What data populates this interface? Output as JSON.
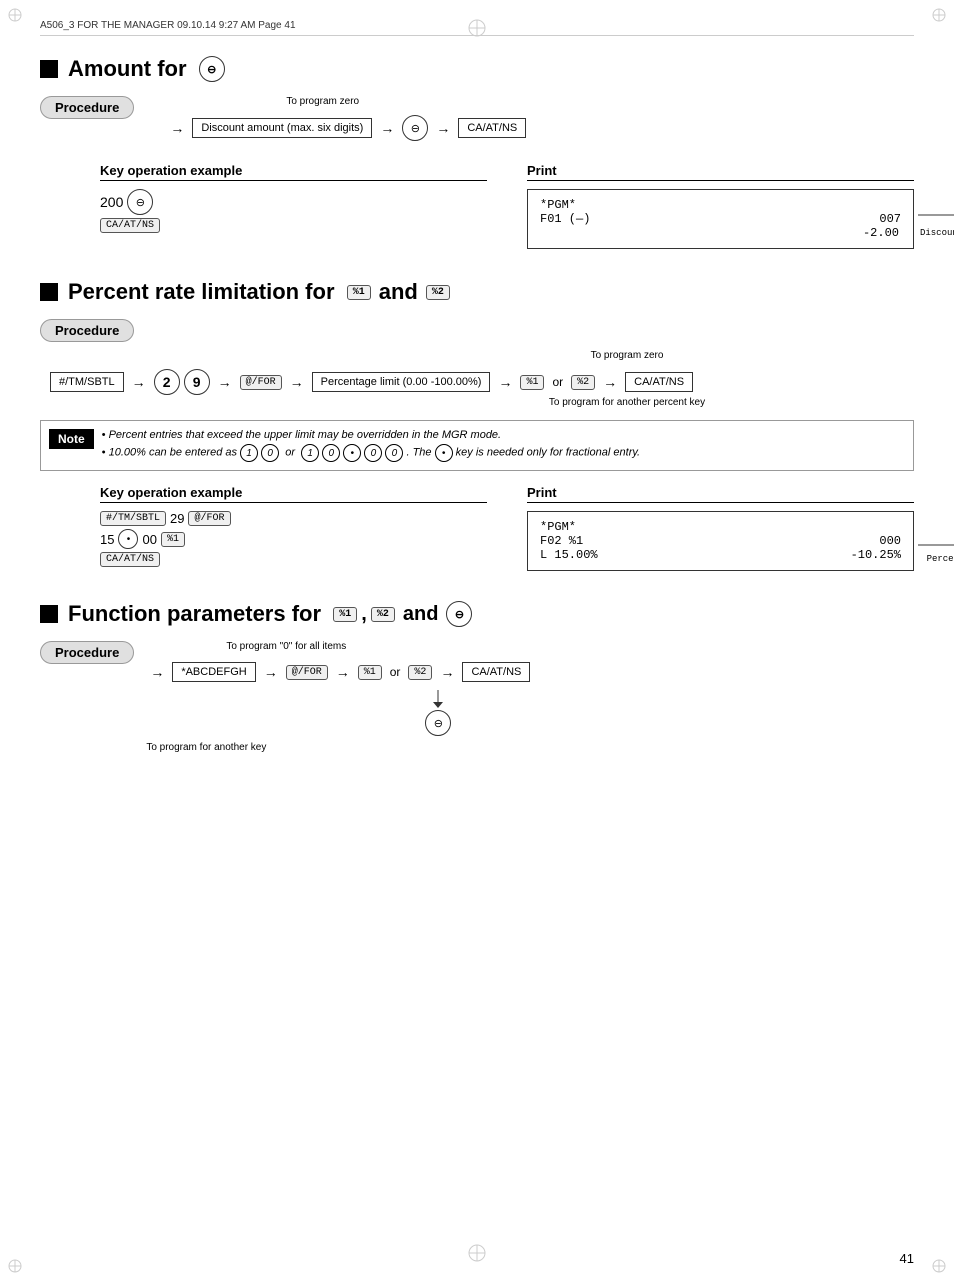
{
  "header": {
    "text": "A506_3 FOR THE MANAGER  09.10.14 9:27 AM  Page 41"
  },
  "page_number": "41",
  "sections": [
    {
      "id": "amount_for",
      "heading": "Amount for",
      "heading_symbol": "⊖",
      "procedure_label": "Procedure",
      "to_program_zero": "To program zero",
      "flow": [
        "Discount amount (max. six digits)",
        "⊖",
        "CA/AT/NS"
      ],
      "key_op_title": "Key operation example",
      "print_title": "Print",
      "key_op_lines": [
        "200 ⊖",
        "CA/AT/NS"
      ],
      "print_lines": [
        "*PGM*",
        "F01  (—)          007",
        "              -2.00"
      ],
      "discount_label": "Discount amount"
    },
    {
      "id": "percent_rate",
      "heading": "Percent rate limitation for",
      "heading_symbols": [
        "%1",
        "%2"
      ],
      "heading_and": "and",
      "procedure_label": "Procedure",
      "to_program_zero": "To program zero",
      "to_program_another": "To program for another percent key",
      "flow_items": [
        "#/TM/SBTL",
        "2",
        "9",
        "@/FOR",
        "Percentage limit (0.00 -100.00%)",
        "%1",
        "or",
        "%2",
        "CA/AT/NS"
      ],
      "note_label": "Note",
      "notes": [
        "• Percent entries that exceed the upper limit may be overridden in the MGR mode.",
        "• 10.00% can be entered as (1)(0) or (1)(0)(•)(0)(0).  The (•) key is needed only for fractional entry."
      ],
      "key_op_title": "Key operation example",
      "print_title": "Print",
      "key_op_lines": [
        "#/TM/SBTL  29  @/FOR",
        "15  (•)  00  %1",
        "CA/AT/NS"
      ],
      "print_lines": [
        "*PGM*",
        "F02 %1           000",
        "L 15.00%    -10.25%"
      ],
      "percentage_label": "Percentage limit"
    },
    {
      "id": "function_params",
      "heading": "Function parameters for",
      "heading_symbols": [
        "%1",
        ",",
        "%2",
        "and",
        "⊖"
      ],
      "procedure_label": "Procedure",
      "to_program_zero_label": "To program \"0\" for all items",
      "to_program_another": "To program for another key",
      "flow_items": [
        "*ABCDEFGH",
        "@/FOR",
        "%1",
        "or",
        "%2",
        "CA/AT/NS",
        "⊖"
      ]
    }
  ]
}
